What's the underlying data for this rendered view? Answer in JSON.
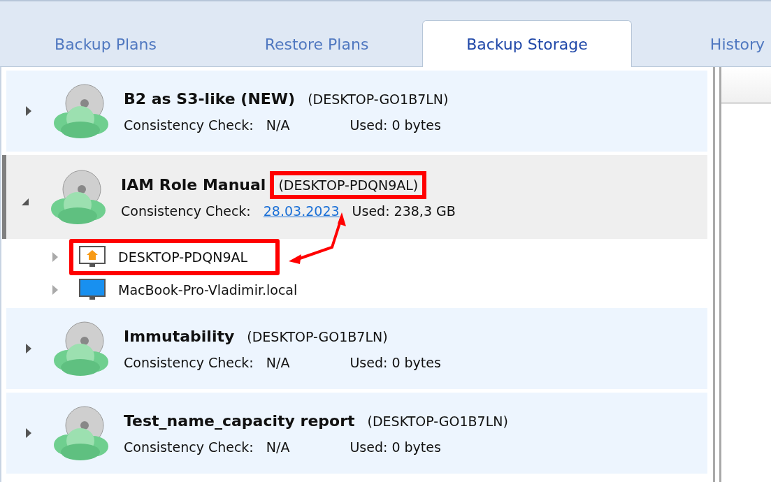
{
  "tabs": [
    {
      "label": "Backup Plans",
      "selected": false
    },
    {
      "label": "Restore Plans",
      "selected": false
    },
    {
      "label": "Backup Storage",
      "selected": true
    },
    {
      "label": "History",
      "selected": false
    }
  ],
  "storages": [
    {
      "name": "B2 as S3-like (NEW)",
      "host": "(DESKTOP-GO1B7LN)",
      "host_highlighted": false,
      "check_label": "Consistency Check:",
      "check_value": "N/A",
      "kind": "text",
      "used": "Used: 0 bytes",
      "expanded": false,
      "selected": false
    },
    {
      "name": "IAM Role Manual",
      "host": "(DESKTOP-PDQN9AL)",
      "host_highlighted": true,
      "check_label": "Consistency Check:",
      "check_value": "28.03.2023",
      "kind": "link",
      "used": "Used: 238,3 GB",
      "expanded": true,
      "selected": true,
      "children": [
        {
          "name": "DESKTOP-PDQN9AL",
          "kind": "home",
          "highlighted": true,
          "expanded": false
        },
        {
          "name": "MacBook-Pro-Vladimir.local",
          "kind": "monitor",
          "highlighted": false,
          "expanded": false
        }
      ]
    },
    {
      "name": "Immutability",
      "host": "(DESKTOP-GO1B7LN)",
      "host_highlighted": false,
      "check_label": "Consistency Check:",
      "check_value": "N/A",
      "kind": "text",
      "used": "Used: 0 bytes",
      "expanded": false,
      "selected": false
    },
    {
      "name": "Test_name_capacity report",
      "host": "(DESKTOP-GO1B7LN)",
      "host_highlighted": false,
      "check_label": "Consistency Check:",
      "check_value": "N/A",
      "kind": "text",
      "used": "Used: 0 bytes",
      "expanded": false,
      "selected": false
    }
  ]
}
